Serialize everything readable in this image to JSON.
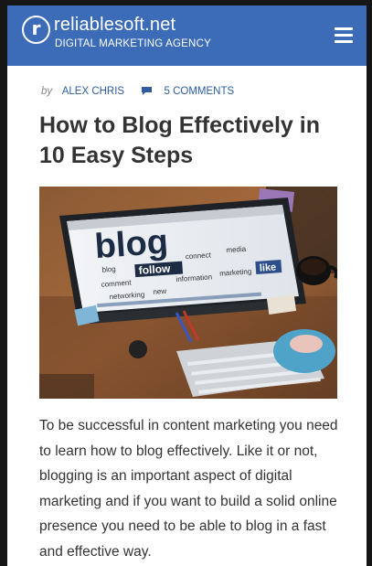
{
  "header": {
    "logo_letter": "r",
    "site_name": "reliablesoft.net",
    "tagline": "DIGITAL MARKETING AGENCY"
  },
  "post": {
    "by_label": "by",
    "author": "ALEX CHRIS",
    "comments": "5 COMMENTS",
    "title": "How to Blog Effectively in 10 Easy Steps",
    "image_words": {
      "blog": "blog",
      "blog_small": "blog",
      "follow": "follow",
      "connect": "connect",
      "media": "media",
      "comment": "comment",
      "networking": "networking",
      "new": "new",
      "information": "information",
      "marketing": "marketing",
      "like": "like"
    },
    "intro": "To be successful in content marketing you need to learn how to blog effectively. Like it or not, blogging is an important aspect of digital marketing and if you want to build a solid online presence you need to be able to blog in a fast and effective way."
  },
  "colors": {
    "header_bg": "#3c6cb7",
    "link": "#2e5c9e",
    "text": "#333333"
  }
}
